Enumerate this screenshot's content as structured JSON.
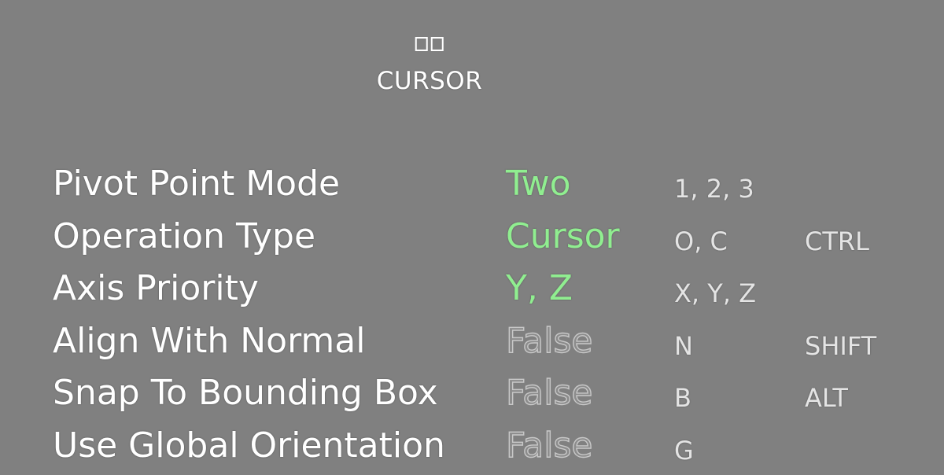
{
  "header": {
    "icon": "two-boxes-icon",
    "title": "CURSOR"
  },
  "colors": {
    "background": "#808080",
    "active_value": "#90ee90",
    "inactive_value": "#8c8c8c",
    "text": "#ffffff"
  },
  "rows": [
    {
      "label": "Pivot Point Mode",
      "value": "Two",
      "active": true,
      "keys": "1, 2, 3",
      "modifier": ""
    },
    {
      "label": "Operation Type",
      "value": "Cursor",
      "active": true,
      "keys": "O, C",
      "modifier": "CTRL"
    },
    {
      "label": "Axis Priority",
      "value": "Y, Z",
      "active": true,
      "keys": "X, Y, Z",
      "modifier": ""
    },
    {
      "label": "Align With Normal",
      "value": "False",
      "active": false,
      "keys": "N",
      "modifier": "SHIFT"
    },
    {
      "label": "Snap To Bounding Box",
      "value": "False",
      "active": false,
      "keys": "B",
      "modifier": "ALT"
    },
    {
      "label": "Use Global Orientation",
      "value": "False",
      "active": false,
      "keys": "G",
      "modifier": ""
    }
  ]
}
